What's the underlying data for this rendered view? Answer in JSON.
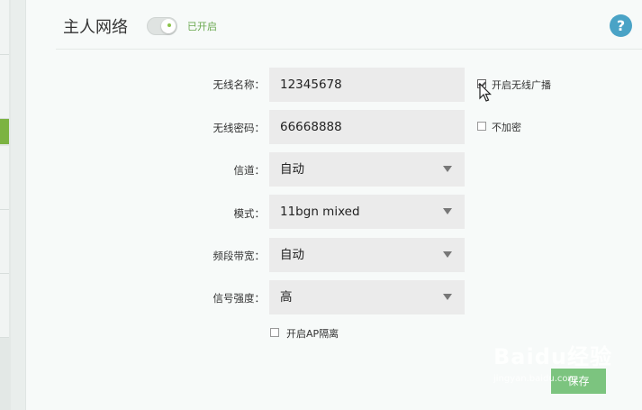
{
  "header": {
    "title": "主人网络",
    "toggle_status": "已开启",
    "help_label": "?"
  },
  "form": {
    "ssid_label": "无线名称：",
    "ssid_value": "12345678",
    "password_label": "无线密码：",
    "password_value": "66668888",
    "channel_label": "信道：",
    "channel_value": "自动",
    "mode_label": "模式：",
    "mode_value": "11bgn mixed",
    "bandwidth_label": "频段带宽：",
    "bandwidth_value": "自动",
    "signal_label": "信号强度：",
    "signal_value": "高"
  },
  "options": {
    "broadcast_label": "开启无线广播",
    "broadcast_checked": true,
    "no_encrypt_label": "不加密",
    "no_encrypt_checked": false,
    "ap_isolation_label": "开启AP隔离",
    "ap_isolation_checked": false
  },
  "footer": {
    "save_label": "保存"
  },
  "watermark": {
    "brand": "Baidu经验",
    "url": "jingyan.baidu.com"
  },
  "colors": {
    "accent_green": "#7cb342",
    "help_blue": "#4aa3c6",
    "status_green": "#6aa84f"
  }
}
